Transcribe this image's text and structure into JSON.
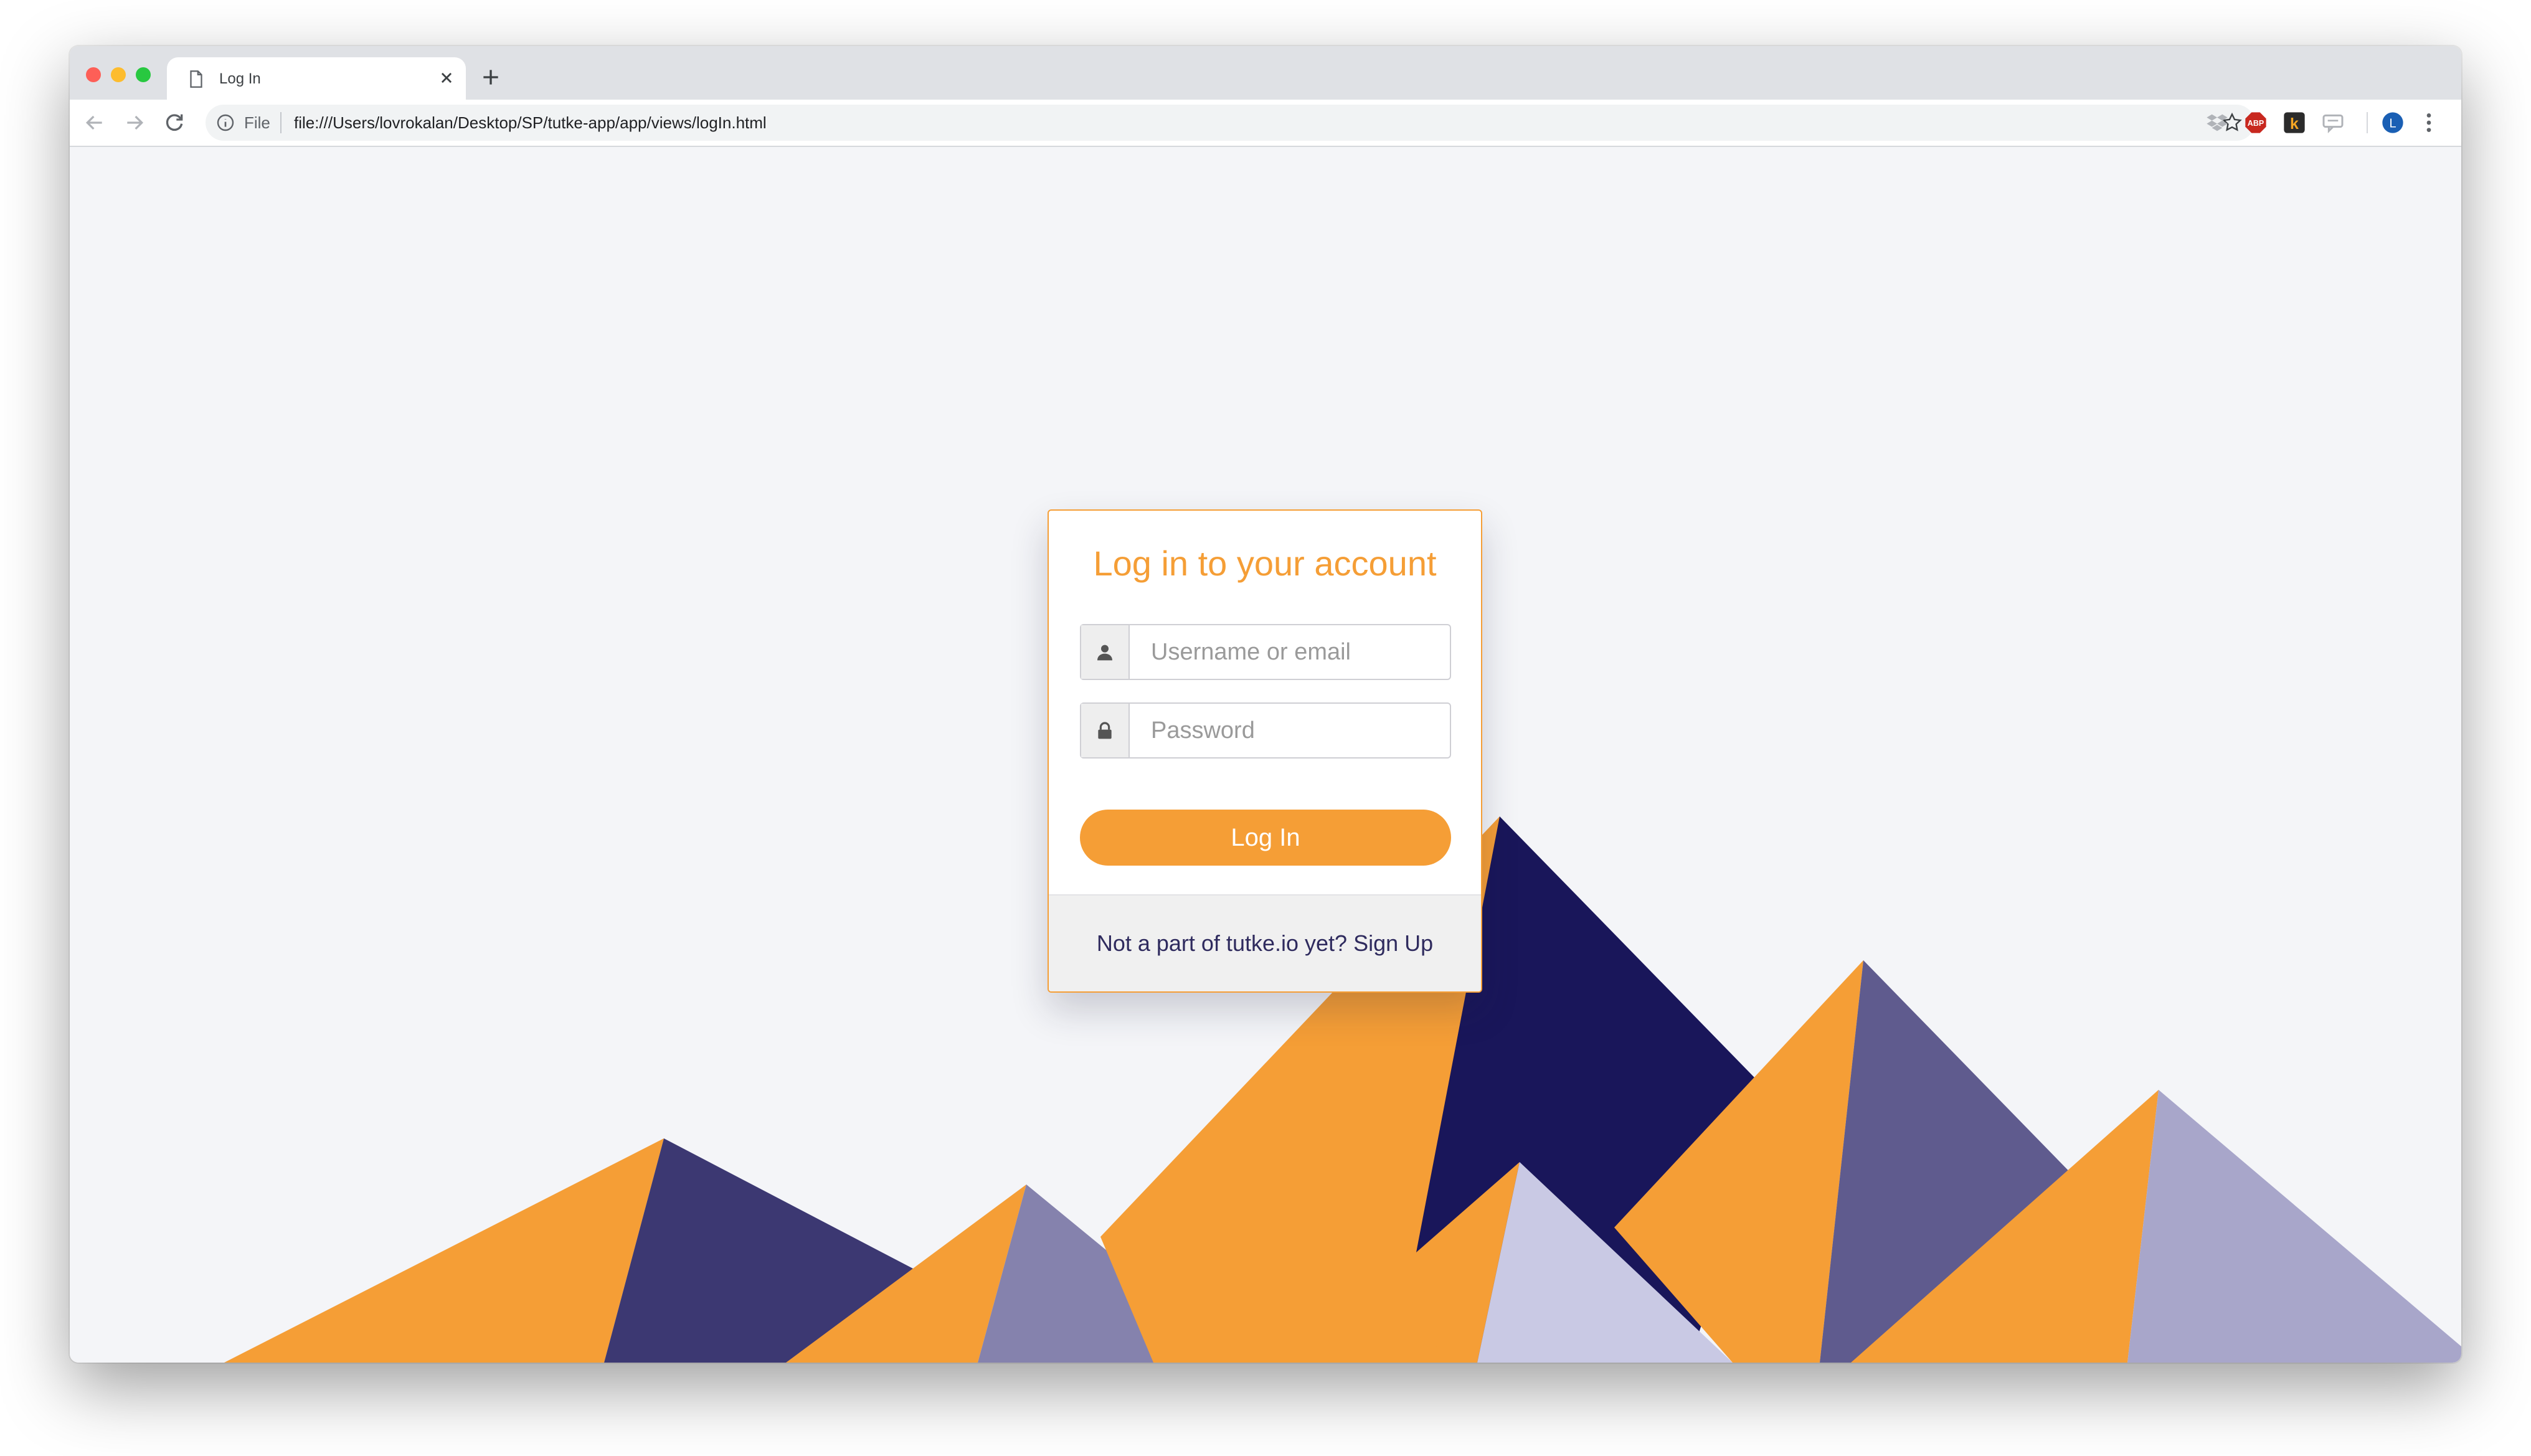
{
  "browser": {
    "tab_title": "Log In",
    "address_scheme": "File",
    "url": "file:///Users/lovrokalan/Desktop/SP/tutke-app/app/views/logIn.html",
    "profile_initial": "L",
    "extensions": [
      "dropbox-icon",
      "adblock-plus-icon",
      "k-extension-icon",
      "chat-extension-icon"
    ]
  },
  "login": {
    "title": "Log in to your account",
    "username_placeholder": "Username or email",
    "password_placeholder": "Password",
    "submit_label": "Log In",
    "footer_text": "Not a part of tutke.io yet?",
    "signup_link": "Sign Up"
  },
  "colors": {
    "accent": "#f59e36",
    "navy": "#19165a",
    "indigo": "#3c3872",
    "slate": "#5f5b8e",
    "lavender": "#8582ad",
    "lilac": "#a8a6ca",
    "pale": "#c9c9e4",
    "background": "#f4f5f8"
  }
}
